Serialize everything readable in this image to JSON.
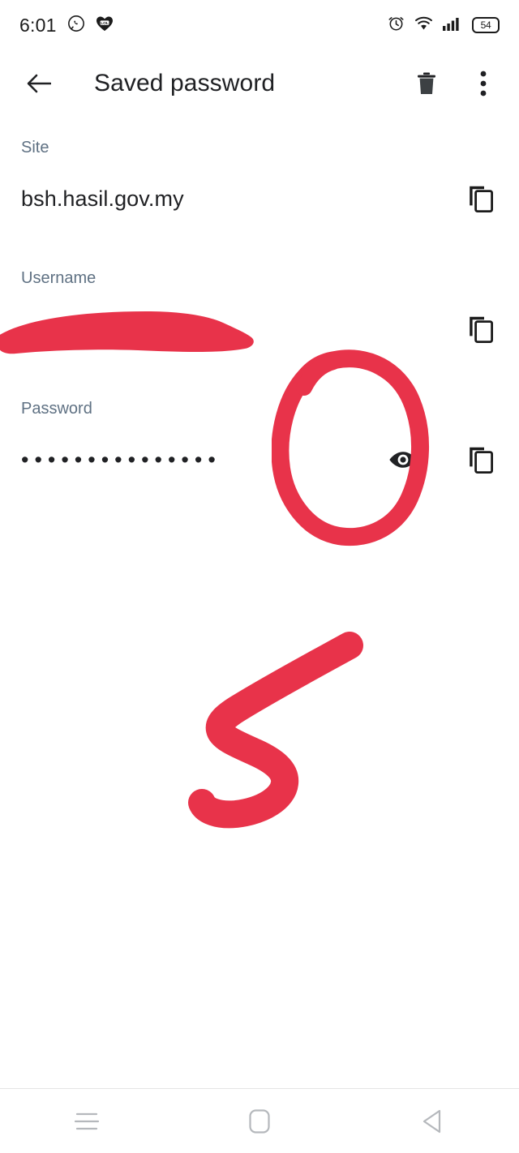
{
  "statusbar": {
    "time": "6:01",
    "battery_level": "54",
    "left_icons": [
      {
        "name": "whatsapp-icon"
      },
      {
        "name": "app-notification-icon"
      }
    ],
    "right_icons": [
      {
        "name": "alarm-icon"
      },
      {
        "name": "wifi-icon"
      },
      {
        "name": "cellular-signal-icon"
      }
    ]
  },
  "appbar": {
    "title": "Saved password",
    "back_label": "Back",
    "delete_label": "Delete",
    "overflow_label": "More options"
  },
  "fields": {
    "site": {
      "label": "Site",
      "value": "bsh.hasil.gov.my",
      "copy_label": "Copy site"
    },
    "username": {
      "label": "Username",
      "value": "",
      "redacted": "true",
      "copy_label": "Copy username"
    },
    "password": {
      "label": "Password",
      "value": "•••••••••••••••",
      "masked": "true",
      "show_label": "Show password",
      "copy_label": "Copy password"
    }
  },
  "annotations": {
    "color": "#E8334A",
    "items": [
      {
        "name": "username-redaction-scribble",
        "shape": "thick-horizontal-strike"
      },
      {
        "name": "eye-icon-highlight-circle",
        "shape": "hand-drawn-oval"
      },
      {
        "name": "step-number-five",
        "shape": "hand-drawn-digit-5"
      }
    ]
  },
  "navbar": {
    "recents_label": "Recent apps",
    "home_label": "Home",
    "back_label": "Back"
  }
}
